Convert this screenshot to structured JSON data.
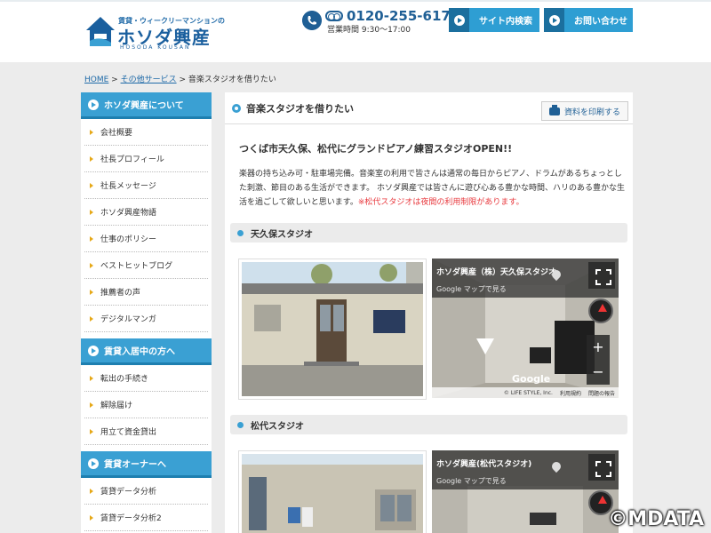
{
  "header": {
    "logo_sub": "賃貸・ウィークリーマンションの",
    "logo_main": "ホソダ興産",
    "logo_roman": "HOSODA KOUSAN",
    "tel_number": "0120-255-617",
    "tel_hours": "営業時間 9:30〜17:00",
    "btn_search": "サイト内検索",
    "btn_contact": "お問い合わせ"
  },
  "breadcrumb": {
    "home": "HOME",
    "sep": " > ",
    "parent": "その他サービス",
    "current": "音楽スタジオを借りたい"
  },
  "sidebar": {
    "groups": [
      {
        "title": "ホソダ興産について",
        "items": [
          "会社概要",
          "社長プロフィール",
          "社長メッセージ",
          "ホソダ興産物語",
          "仕事のポリシー",
          "ベストヒットブログ",
          "推薦者の声",
          "デジタルマンガ"
        ]
      },
      {
        "title": "賃貸入居中の方へ",
        "items": [
          "転出の手続き",
          "解除届け",
          "用立て資金貸出"
        ]
      },
      {
        "title": "賃貸オーナーへ",
        "items": [
          "賃貸データ分析",
          "賃貸データ分析2"
        ]
      }
    ]
  },
  "main": {
    "title": "音楽スタジオを借りたい",
    "print_label": "資料を印刷する",
    "lead": "つくば市天久保、松代にグランドピアノ練習スタジオOPEN!!",
    "body": "楽器の持ち込み可・駐車場完備。音楽室の利用で皆さんは通常の毎日からピアノ、ドラムがあるちょっとした刺激、節目のある生活ができます。 ホソダ興産では皆さんに遊び心ある豊かな時間、ハリのある豊かな生活を過ごして欲しいと思います。",
    "note": "※松代スタジオは夜間の利用制限があります。",
    "sections": [
      {
        "title": "天久保スタジオ",
        "map_title": "ホソダ興産（株）天久保スタジオ",
        "map_link": "Google マップで見る",
        "map_google": "Google",
        "map_copyright": "© LIFE STYLE, Inc.",
        "map_terms": "利用規約",
        "map_report": "問題の報告",
        "zoom_in": "+",
        "zoom_out": "−"
      },
      {
        "title": "松代スタジオ",
        "map_title": "ホソダ興産(松代スタジオ)",
        "map_link": "Google マップで見る"
      }
    ]
  },
  "watermark": "©MDATA",
  "colors": {
    "accent": "#3aa0d3",
    "brand": "#1f5f95",
    "bullet": "#e6a817",
    "note": "#e8383d"
  }
}
